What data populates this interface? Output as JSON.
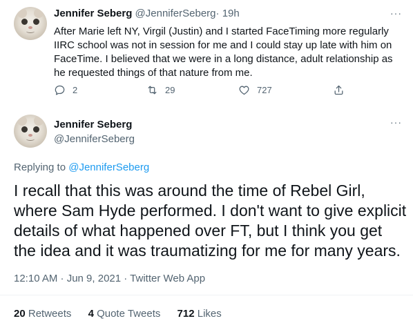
{
  "tweet1": {
    "name": "Jennifer Seberg",
    "handle": "@JenniferSeberg",
    "separator": "·",
    "time": "19h",
    "text": "After Marie left NY, Virgil (Justin) and I started FaceTiming more regularly IIRC school was not in session for me and I could stay up late with him on FaceTime. I believed that we were in a long distance, adult relationship as he requested things of that nature from me.",
    "actions": {
      "reply_count": "2",
      "retweet_count": "29",
      "like_count": "727"
    },
    "more": "···"
  },
  "tweet2": {
    "name": "Jennifer Seberg",
    "handle": "@JenniferSeberg",
    "more": "···",
    "replying_prefix": "Replying to ",
    "replying_handle": "@JenniferSeberg",
    "text": "I recall that this was around the time of Rebel Girl, where Sam Hyde performed. I don't want to give explicit details of what happened over FT, but I think you get the idea and it was traumatizing for me for many years.",
    "meta": "12:10 AM · Jun 9, 2021 · Twitter Web App",
    "stats": {
      "retweets_value": "20",
      "retweets_label": "Retweets",
      "quotes_value": "4",
      "quotes_label": "Quote Tweets",
      "likes_value": "712",
      "likes_label": "Likes"
    }
  },
  "colors": {
    "text": "#0f1419",
    "muted": "#536471",
    "link": "#1d9bf0",
    "divider": "#eff3f4"
  }
}
